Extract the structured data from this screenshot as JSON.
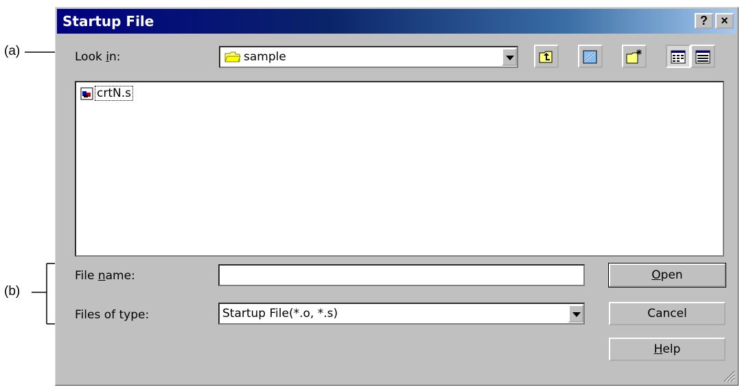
{
  "annotations": {
    "a": "(a)",
    "b": "(b)"
  },
  "window": {
    "title": "Startup File",
    "help_btn": "?",
    "close_btn": "×"
  },
  "look_in": {
    "label_pre": "Look ",
    "label_u": "i",
    "label_post": "n:",
    "value": "sample"
  },
  "files": [
    {
      "name": "crtN.s"
    }
  ],
  "file_name": {
    "label_pre": "File ",
    "label_u": "n",
    "label_post": "ame:",
    "value": ""
  },
  "file_type": {
    "label": "Files of type:",
    "value": "Startup File(*.o, *.s)"
  },
  "buttons": {
    "open_u": "O",
    "open_rest": "pen",
    "cancel": "Cancel",
    "help_u": "H",
    "help_rest": "elp"
  },
  "toolbar_icons": [
    "up-folder-icon",
    "desktop-icon",
    "new-folder-icon",
    "list-view-icon",
    "details-view-icon"
  ],
  "colors": {
    "titlebar_start": "#000080",
    "titlebar_end": "#a6caf0",
    "face": "#c0c0c0"
  }
}
